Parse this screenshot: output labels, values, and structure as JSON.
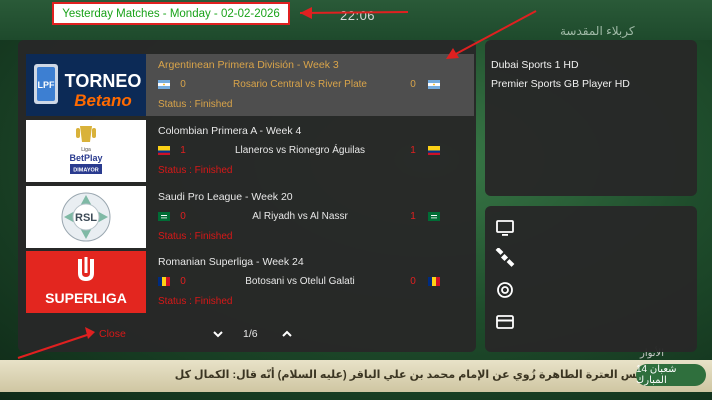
{
  "header": {
    "title": "Yesterday Matches - Monday - 02-02-2026"
  },
  "background": {
    "clock": "22:06",
    "rtl_title": "كربلاء المقدسة",
    "ticker_text": "فيس العترة الطاهرة   زُوي عن الإمام محمد بن علي الباقر (عليه السلام) أنّه قال: الكمال كل",
    "ticker_badge": "14 شعبان المبارك",
    "small_rtl": "الأنوار"
  },
  "matches": [
    {
      "league": "Argentinean Primera División - Week 3",
      "home_score": "0",
      "teams": "Rosario Central vs River Plate",
      "away_score": "0",
      "status": "Status : Finished",
      "logo": "Torneo Betano",
      "home_flag": "argentina-flag",
      "away_flag": "argentina-flag"
    },
    {
      "league": "Colombian Primera A - Week 4",
      "home_score": "1",
      "teams": "Llaneros vs Rionegro Águilas",
      "away_score": "1",
      "status": "Status : Finished",
      "logo": "BetPlay Dimayor",
      "home_flag": "colombia-flag",
      "away_flag": "colombia-flag"
    },
    {
      "league": "Saudi Pro League - Week 20",
      "home_score": "0",
      "teams": "Al Riyadh vs Al Nassr",
      "away_score": "1",
      "status": "Status : Finished",
      "logo": "RSL",
      "home_flag": "saudi-flag",
      "away_flag": "saudi-flag"
    },
    {
      "league": "Romanian Superliga - Week 24",
      "home_score": "0",
      "teams": "Botosani vs Otelul Galati",
      "away_score": "0",
      "status": "Status : Finished",
      "logo": "Superliga",
      "home_flag": "romania-flag",
      "away_flag": "romania-flag"
    }
  ],
  "logos": {
    "torneo_line1": "TORNEO",
    "torneo_line2": "Betano",
    "lpf": "LPF",
    "betplay_line1": "Liga",
    "betplay_line2": "BetPlay",
    "betplay_line3": "DIMAYOR",
    "rsl": "RSL",
    "superliga": "SUPERLIGA"
  },
  "footer": {
    "close_label": "Close",
    "page_indicator": "1/6",
    "down_icon": "chevron-down-icon",
    "up_icon": "chevron-up-icon"
  },
  "channels": [
    "Dubai Sports 1 HD",
    "Premier Sports GB Player HD"
  ],
  "side_icons": [
    "monitor-icon",
    "satellite-icon",
    "at-sign-icon",
    "card-icon"
  ],
  "colors": {
    "selected_text": "#d9a44a",
    "red": "#d81818",
    "header_green": "#1aa31a"
  }
}
